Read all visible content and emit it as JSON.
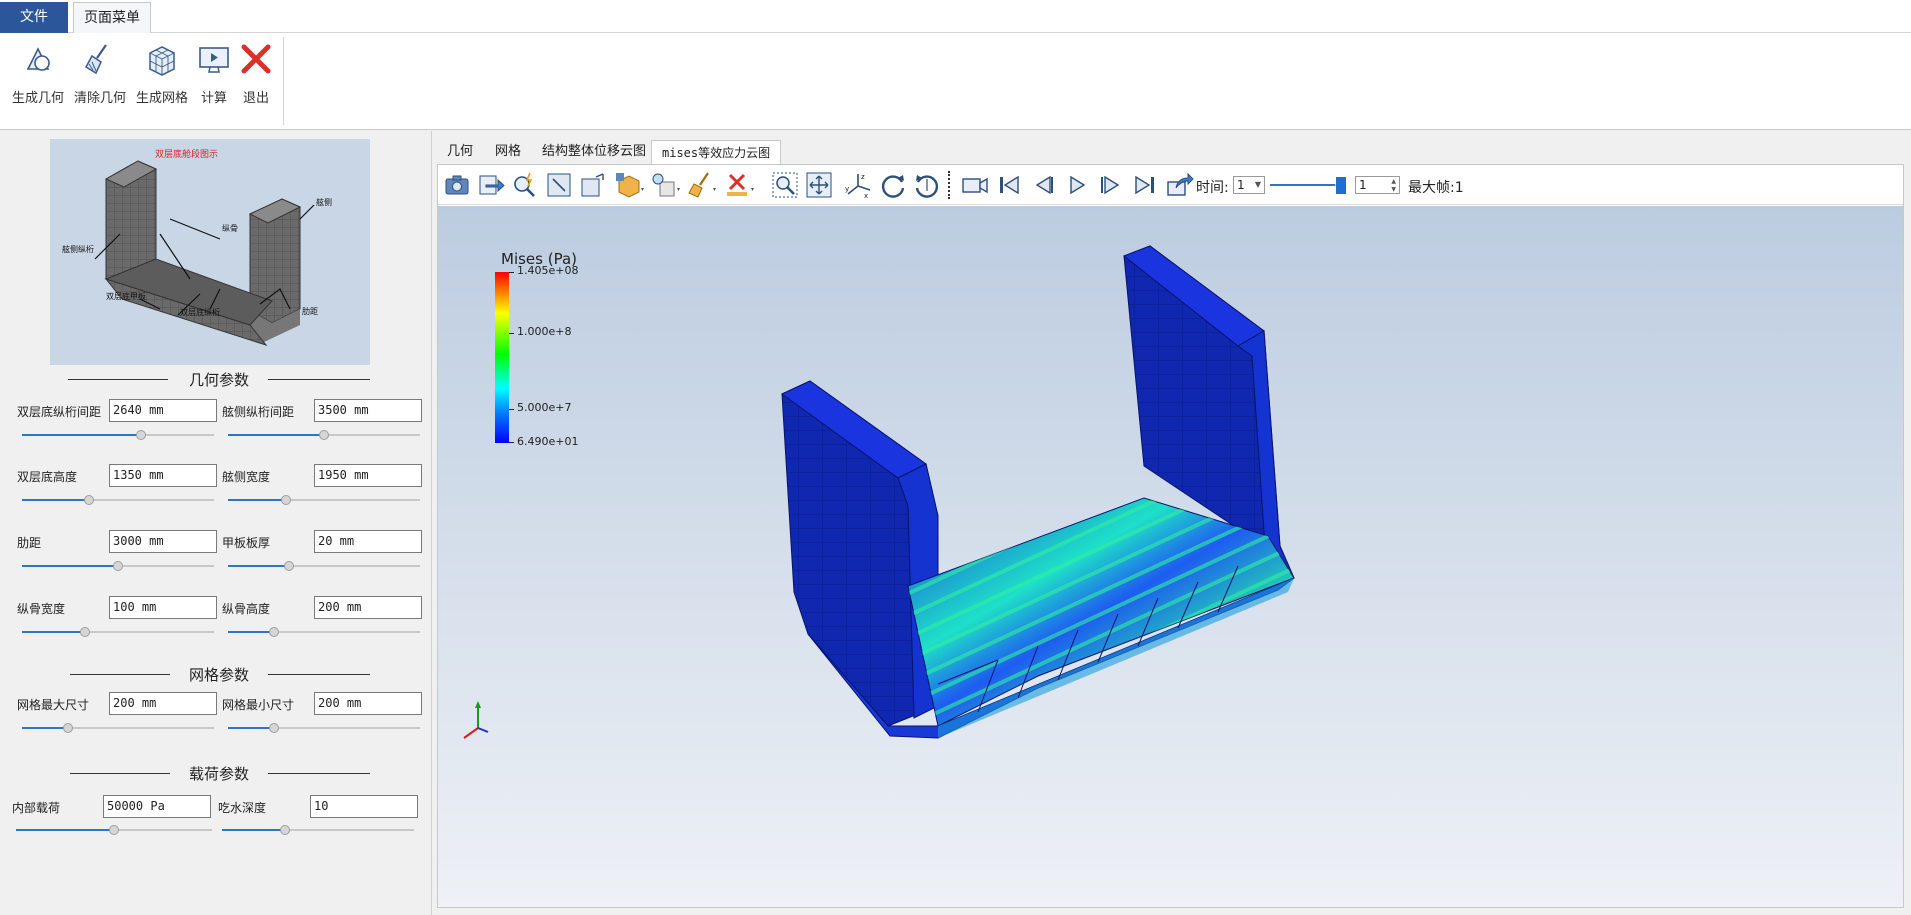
{
  "ribbon": {
    "tabs": [
      "文件",
      "页面菜单"
    ],
    "buttons": [
      {
        "label": "生成几何",
        "icon": "geometry-icon"
      },
      {
        "label": "清除几何",
        "icon": "broom-icon"
      },
      {
        "label": "生成网格",
        "icon": "mesh-cube-icon"
      },
      {
        "label": "计算",
        "icon": "monitor-icon"
      },
      {
        "label": "退出",
        "icon": "close-x-icon"
      }
    ]
  },
  "diagram": {
    "title": "双层底舱段图示",
    "labels": [
      "舷侧",
      "纵骨",
      "舷侧纵桁",
      "双层底甲板",
      "双层底纵桁",
      "肋距"
    ]
  },
  "geometry": {
    "title": "几何参数",
    "params": [
      {
        "label": "双层底纵桁间距",
        "value": "2640 mm",
        "slider": 0.62
      },
      {
        "label": "舷侧纵桁间距",
        "value": "3500 mm",
        "slider": 0.5
      },
      {
        "label": "双层底高度",
        "value": "1350 mm",
        "slider": 0.35
      },
      {
        "label": "舷侧宽度",
        "value": "1950 mm",
        "slider": 0.3
      },
      {
        "label": "肋距",
        "value": "3000 mm",
        "slider": 0.5
      },
      {
        "label": "甲板板厚",
        "value": "20 mm",
        "slider": 0.32
      },
      {
        "label": "纵骨宽度",
        "value": "100 mm",
        "slider": 0.33
      },
      {
        "label": "纵骨高度",
        "value": "200 mm",
        "slider": 0.24
      }
    ]
  },
  "mesh": {
    "title": "网格参数",
    "params": [
      {
        "label": "网格最大尺寸",
        "value": "200 mm",
        "slider": 0.24
      },
      {
        "label": "网格最小尺寸",
        "value": "200 mm",
        "slider": 0.24
      }
    ]
  },
  "load": {
    "title": "载荷参数",
    "params": [
      {
        "label": "内部载荷",
        "value": "50000 Pa",
        "slider": 0.5
      },
      {
        "label": "吃水深度",
        "value": "10",
        "slider": 0.33
      }
    ]
  },
  "view": {
    "tabs": [
      "几何",
      "网格",
      "结构整体位移云图",
      "mises等效应力云图"
    ],
    "active_tab": 3,
    "time_label": "时间:",
    "time_value": "1",
    "frame_value": "1",
    "max_frame": "最大帧:1",
    "time_slider": 0.98
  },
  "legend": {
    "title": "Mises (Pa)",
    "labels": [
      "1.405e+08",
      "1.000e+8",
      "5.000e+7",
      "6.490e+01"
    ],
    "colors": {
      "max": "#ff0000",
      "min": "#0000ff"
    }
  }
}
